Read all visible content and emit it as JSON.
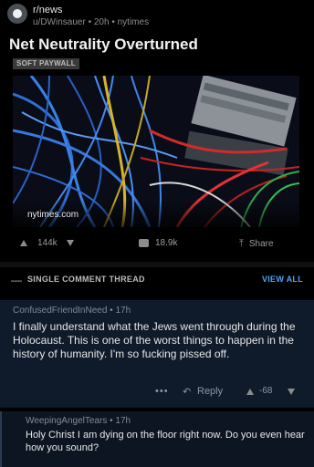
{
  "post": {
    "subreddit": "r/news",
    "author": "u/DWinsauer",
    "age": "20h",
    "domain": "nytimes",
    "title": "Net Neutrality Overturned",
    "badge": "SOFT PAYWALL",
    "link_domain": "nytimes.com",
    "upvotes": "144k",
    "comments": "18.9k",
    "share_label": "Share"
  },
  "thread": {
    "close_glyph": "—",
    "label": "SINGLE COMMENT THREAD",
    "view_all": "VIEW ALL"
  },
  "comments": [
    {
      "user": "ConfusedFriendInNeed",
      "age": "17h",
      "text": "I finally understand what the Jews went through during the Holocaust. This is one of the worst things to happen in the history of humanity. I'm so fucking pissed off.",
      "dots": "•••",
      "reply_label": "Reply",
      "score": "-68"
    },
    {
      "user": "WeepingAngelTears",
      "age": "17h",
      "text": "Holy Christ I am dying on the floor right now. Do you even hear how you sound?"
    }
  ],
  "icons": {
    "reply": "↶",
    "share": "⤒"
  },
  "colors": {
    "background": "#000000",
    "comment_bg": "#0f1a2b",
    "link_blue": "#4fa3f7"
  }
}
